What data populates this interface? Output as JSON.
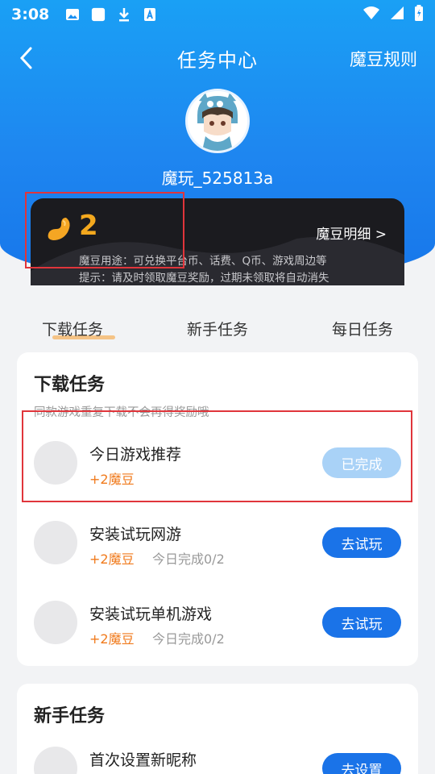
{
  "status_bar": {
    "time": "3:08"
  },
  "header": {
    "title": "任务中心",
    "rules_label": "魔豆规则",
    "username": "魔玩_525813a"
  },
  "bean_card": {
    "count": "2",
    "detail_label": "魔豆明细 >",
    "usage_text": "魔豆用途：可兑换平台币、话费、Q币、游戏周边等",
    "tip_text": "提示：请及时领取魔豆奖励，过期未领取将自动消失"
  },
  "tabs": [
    {
      "label": "下载任务",
      "active": true
    },
    {
      "label": "新手任务",
      "active": false
    },
    {
      "label": "每日任务",
      "active": false
    }
  ],
  "download_section": {
    "title": "下载任务",
    "subtitle": "同款游戏重复下载不会再得奖励哦",
    "tasks": [
      {
        "name": "今日游戏推荐",
        "reward": "+2魔豆",
        "progress": "",
        "button": "已完成",
        "completed": true
      },
      {
        "name": "安装试玩网游",
        "reward": "+2魔豆",
        "progress": "今日完成0/2",
        "button": "去试玩",
        "completed": false
      },
      {
        "name": "安装试玩单机游戏",
        "reward": "+2魔豆",
        "progress": "今日完成0/2",
        "button": "去试玩",
        "completed": false
      }
    ]
  },
  "newbie_section": {
    "title": "新手任务",
    "tasks": [
      {
        "name": "首次设置新昵称",
        "button": "去设置"
      }
    ]
  },
  "colors": {
    "header_blue": "#1e86f0",
    "button_blue": "#1a73e8",
    "reward_orange": "#f07a1c",
    "bean_gold": "#f3a81e",
    "highlight_red": "#e0353b"
  }
}
